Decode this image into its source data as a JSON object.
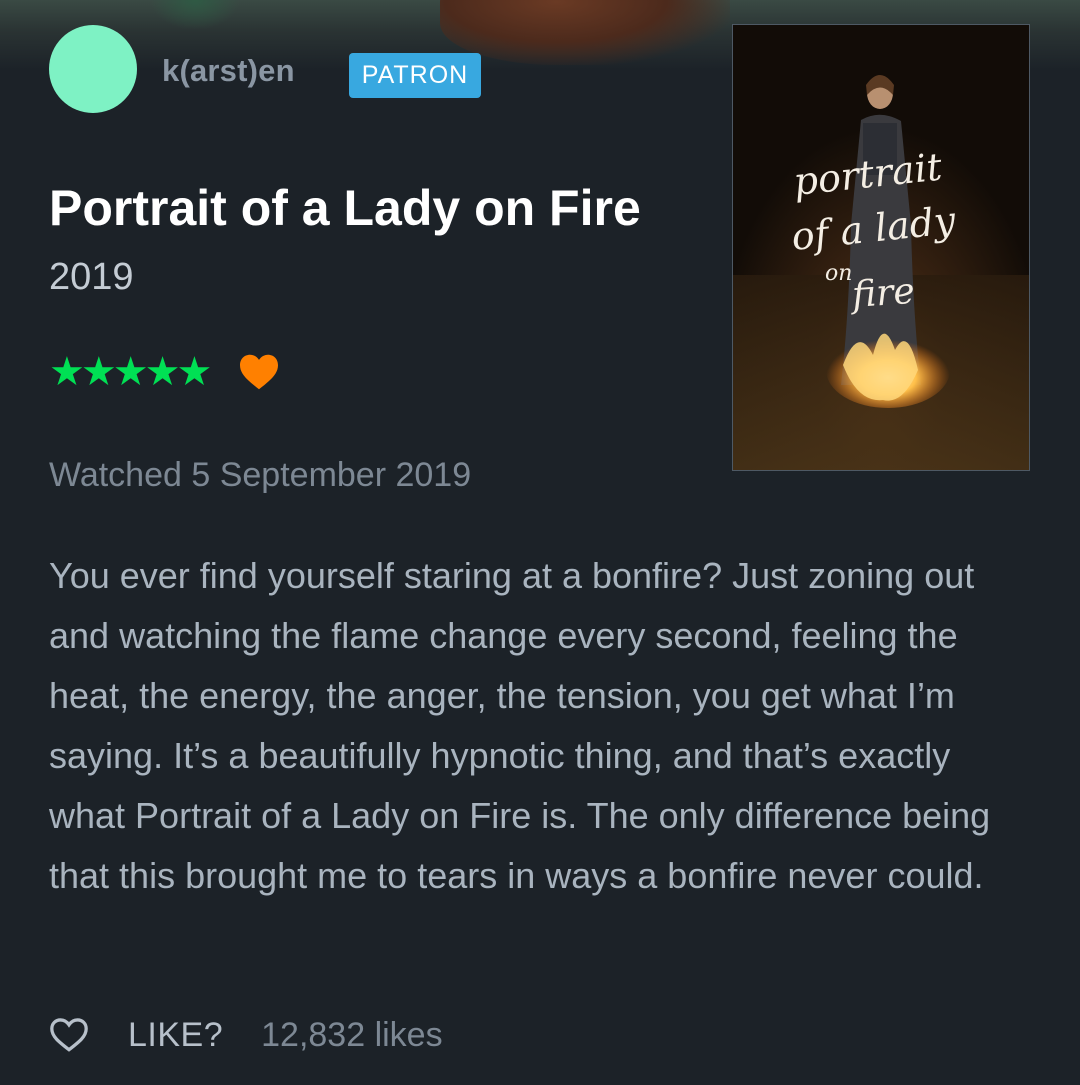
{
  "reviewer": {
    "name": "k(arst)en",
    "badge": "PATRON",
    "avatar_color": "#7ef2c4"
  },
  "film": {
    "title": "Portrait of a Lady on Fire",
    "year": "2019",
    "poster_title_lines": [
      "portrait",
      "of a lady",
      "on",
      "fire"
    ]
  },
  "rating": {
    "stars": 5,
    "stars_text": "★★★★★",
    "liked": true,
    "star_color": "#00e054",
    "heart_color": "#ff8000"
  },
  "watched": "Watched 5 September 2019",
  "review_text": "You ever find yourself staring at a bonfire? Just zoning out and watching the flame change every second, feeling the heat, the energy, the anger, the tension, you get what I’m saying. It’s a beautifully hypnotic thing, and that’s exactly what Portrait of a Lady on Fire is. The only difference being that this brought me to tears in ways a bonfire never could.",
  "actions": {
    "like_label": "LIKE?",
    "likes_count": "12,832 likes"
  },
  "icons": {
    "like": "heart-outline-icon",
    "liked": "heart-filled-icon",
    "rating": "star-icon"
  },
  "colors": {
    "background": "#1c2228",
    "badge": "#38a8e0"
  }
}
